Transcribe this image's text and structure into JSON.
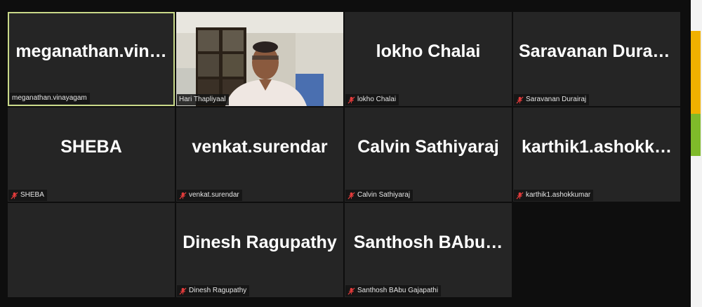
{
  "colors": {
    "tile_bg": "#252525",
    "active_border": "#c9d989",
    "muted_mic": "#e23b3b",
    "scroll_accent": "#f0b100",
    "scroll_accent_2": "#7fba2a"
  },
  "participants": [
    {
      "display": "meganathan.vin…",
      "label": "meganathan.vinayagam",
      "muted": false,
      "active": true
    },
    {
      "display": "",
      "label": "Hari Thapliyaal",
      "muted": false,
      "video": true
    },
    {
      "display": "lokho Chalai",
      "label": "lokho Chalai",
      "muted": true
    },
    {
      "display": "Saravanan  Durai…",
      "label": "Saravanan Durairaj",
      "muted": true
    },
    {
      "display": "SHEBA",
      "label": "SHEBA",
      "muted": true
    },
    {
      "display": "venkat.surendar",
      "label": "venkat.surendar",
      "muted": true
    },
    {
      "display": "Calvin Sathiyaraj",
      "label": "Calvin Sathiyaraj",
      "muted": true
    },
    {
      "display": "karthik1.ashokk…",
      "label": "karthik1.ashokkumar",
      "muted": true
    },
    {
      "display": "Dinesh Ragupathy",
      "label": "Dinesh Ragupathy",
      "muted": true
    },
    {
      "display": "Santhosh  BAbu…",
      "label": "Santhosh BAbu Gajapathi",
      "muted": true
    }
  ]
}
